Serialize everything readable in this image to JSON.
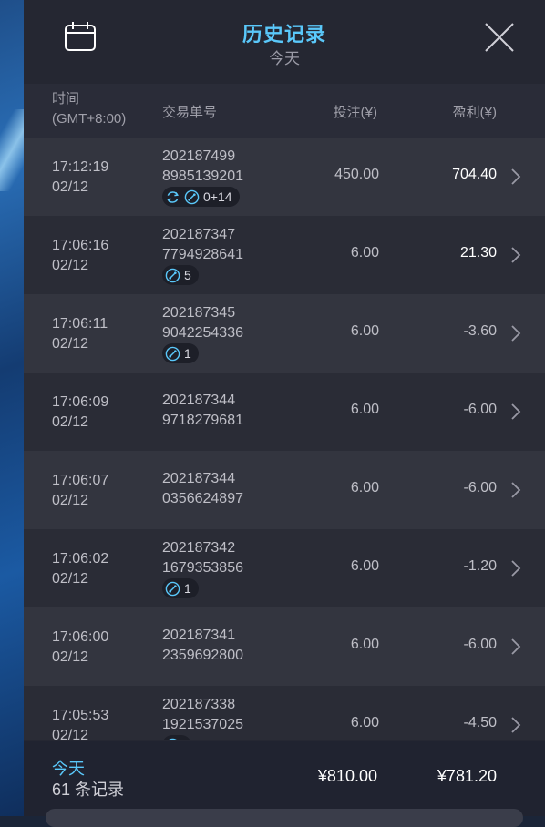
{
  "header": {
    "title": "历史记录",
    "subtitle": "今天"
  },
  "columns": {
    "time_line1": "时间",
    "time_line2": "(GMT+8:00)",
    "order": "交易单号",
    "bet": "投注(¥)",
    "profit": "盈利(¥)"
  },
  "rows": [
    {
      "time": "17:12:19",
      "date": "02/12",
      "order1": "202187499",
      "order2": "8985139201",
      "badge": "0+14",
      "badge_icons": [
        "refresh-icon",
        "parlay-icon"
      ],
      "bet": "450.00",
      "profit": "704.40",
      "positive": true
    },
    {
      "time": "17:06:16",
      "date": "02/12",
      "order1": "202187347",
      "order2": "7794928641",
      "badge": "5",
      "badge_icons": [
        "parlay-icon"
      ],
      "bet": "6.00",
      "profit": "21.30",
      "positive": true
    },
    {
      "time": "17:06:11",
      "date": "02/12",
      "order1": "202187345",
      "order2": "9042254336",
      "badge": "1",
      "badge_icons": [
        "parlay-icon"
      ],
      "bet": "6.00",
      "profit": "-3.60",
      "positive": false
    },
    {
      "time": "17:06:09",
      "date": "02/12",
      "order1": "202187344",
      "order2": "9718279681",
      "badge": "",
      "badge_icons": [],
      "bet": "6.00",
      "profit": "-6.00",
      "positive": false
    },
    {
      "time": "17:06:07",
      "date": "02/12",
      "order1": "202187344",
      "order2": "0356624897",
      "badge": "",
      "badge_icons": [],
      "bet": "6.00",
      "profit": "-6.00",
      "positive": false
    },
    {
      "time": "17:06:02",
      "date": "02/12",
      "order1": "202187342",
      "order2": "1679353856",
      "badge": "1",
      "badge_icons": [
        "parlay-icon"
      ],
      "bet": "6.00",
      "profit": "-1.20",
      "positive": false
    },
    {
      "time": "17:06:00",
      "date": "02/12",
      "order1": "202187341",
      "order2": "2359692800",
      "badge": "",
      "badge_icons": [],
      "bet": "6.00",
      "profit": "-6.00",
      "positive": false
    },
    {
      "time": "17:05:53",
      "date": "02/12",
      "order1": "202187338",
      "order2": "1921537025",
      "badge": "",
      "badge_icons": [
        "parlay-icon"
      ],
      "bet": "6.00",
      "profit": "-4.50",
      "positive": false
    }
  ],
  "footer": {
    "period": "今天",
    "count": "61 条记录",
    "total_bet": "¥810.00",
    "total_profit": "¥781.20"
  },
  "colors": {
    "accent": "#5ac8fa",
    "panel": "#252732",
    "row_odd": "#33353f",
    "row_even": "#2a2c36"
  }
}
